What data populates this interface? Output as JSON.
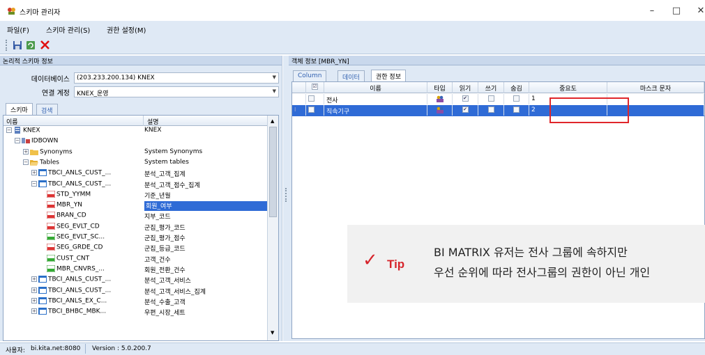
{
  "window": {
    "title": "스키마 관리자",
    "controls": {
      "minimize": "–",
      "maximize": "□",
      "close": "✕"
    }
  },
  "menu": [
    "파일(F)",
    "스키마 관리(S)",
    "권한 설정(M)"
  ],
  "toolbar": {
    "icons": [
      "save-icon",
      "refresh-icon",
      "delete-icon"
    ]
  },
  "left_panel": {
    "header": "논리적 스키마 정보",
    "database_label": "데이터베이스",
    "database_value": "(203.233.200.134) KNEX",
    "account_label": "연결 계정",
    "account_value": "KNEX_운영",
    "tabs": [
      "스키마",
      "검색"
    ],
    "columns": {
      "name": "이름",
      "desc": "설명"
    },
    "tree": [
      {
        "name": "KNEX",
        "desc": "KNEX",
        "level": 0,
        "icon": "database-icon"
      },
      {
        "name": "IDBOWN",
        "desc": "",
        "level": 1,
        "icon": "owner-icon"
      },
      {
        "name": "Synonyms",
        "desc": "System Synonyms",
        "level": 2,
        "icon": "folder-icon"
      },
      {
        "name": "Tables",
        "desc": "System tables",
        "level": 2,
        "icon": "folder-open-icon"
      },
      {
        "name": "TBCI_ANLS_CUST_...",
        "desc": "분석_고객_집계",
        "level": 3,
        "icon": "table-icon"
      },
      {
        "name": "TBCI_ANLS_CUST_...",
        "desc": "분석_고객_점수_집계",
        "level": 3,
        "icon": "table-icon"
      },
      {
        "name": "STD_YYMM",
        "desc": "기준_년월",
        "level": 4,
        "icon": "column-abc-icon"
      },
      {
        "name": "MBR_YN",
        "desc": "회원_여부",
        "level": 4,
        "icon": "column-abc-icon",
        "selected": true
      },
      {
        "name": "BRAN_CD",
        "desc": "지부_코드",
        "level": 4,
        "icon": "column-abc-icon"
      },
      {
        "name": "SEG_EVLT_CD",
        "desc": "군집_평가_코드",
        "level": 4,
        "icon": "column-abc-icon"
      },
      {
        "name": "SEG_EVLT_SC...",
        "desc": "군집_평가_점수",
        "level": 4,
        "icon": "column-num-icon"
      },
      {
        "name": "SEG_GRDE_CD",
        "desc": "군집_등급_코드",
        "level": 4,
        "icon": "column-abc-icon"
      },
      {
        "name": "CUST_CNT",
        "desc": "고객_건수",
        "level": 4,
        "icon": "column-num-icon"
      },
      {
        "name": "MBR_CNVRS_...",
        "desc": "회원_전환_건수",
        "level": 4,
        "icon": "column-num-icon"
      },
      {
        "name": "TBCI_ANLS_CUST_...",
        "desc": "분석_고객_서비스",
        "level": 3,
        "icon": "table-icon"
      },
      {
        "name": "TBCI_ANLS_CUST_...",
        "desc": "분석_고객_서비스_집계",
        "level": 3,
        "icon": "table-icon"
      },
      {
        "name": "TBCI_ANLS_EX_C...",
        "desc": "분석_수출_고객",
        "level": 3,
        "icon": "table-icon"
      },
      {
        "name": "TBCI_BHBC_MBK...",
        "desc": "우편_시장_세트",
        "level": 3,
        "icon": "table-icon"
      }
    ]
  },
  "right_panel": {
    "header": "객체 정보 [MBR_YN]",
    "tabs": [
      "Column",
      "데이터",
      "권한 정보"
    ],
    "grid_columns": [
      "이름",
      "타입",
      "읽기",
      "쓰기",
      "숨김",
      "중요도",
      "마스크 문자"
    ],
    "rows": [
      {
        "name": "전사",
        "type_icon": "group-icon",
        "read": true,
        "write": false,
        "hide": false,
        "importance": "1",
        "mask": ""
      },
      {
        "name": "직속기구",
        "type_icon": "group-icon",
        "read": true,
        "write": false,
        "hide": false,
        "importance": "2",
        "mask": "",
        "selected": true
      }
    ],
    "highlight_color": "#e0262a"
  },
  "tip": {
    "label": "Tip",
    "check": "✓",
    "line1": "BI MATRIX 유저는 전사 그룹에 속하지만",
    "line2": "우선 순위에 따라 전사그룹의 권한이 아닌 개인"
  },
  "status": {
    "user_label": "사용자:",
    "user_value": "bi.kita.net:8080",
    "version_label": "Version : 5.0.200.7"
  }
}
